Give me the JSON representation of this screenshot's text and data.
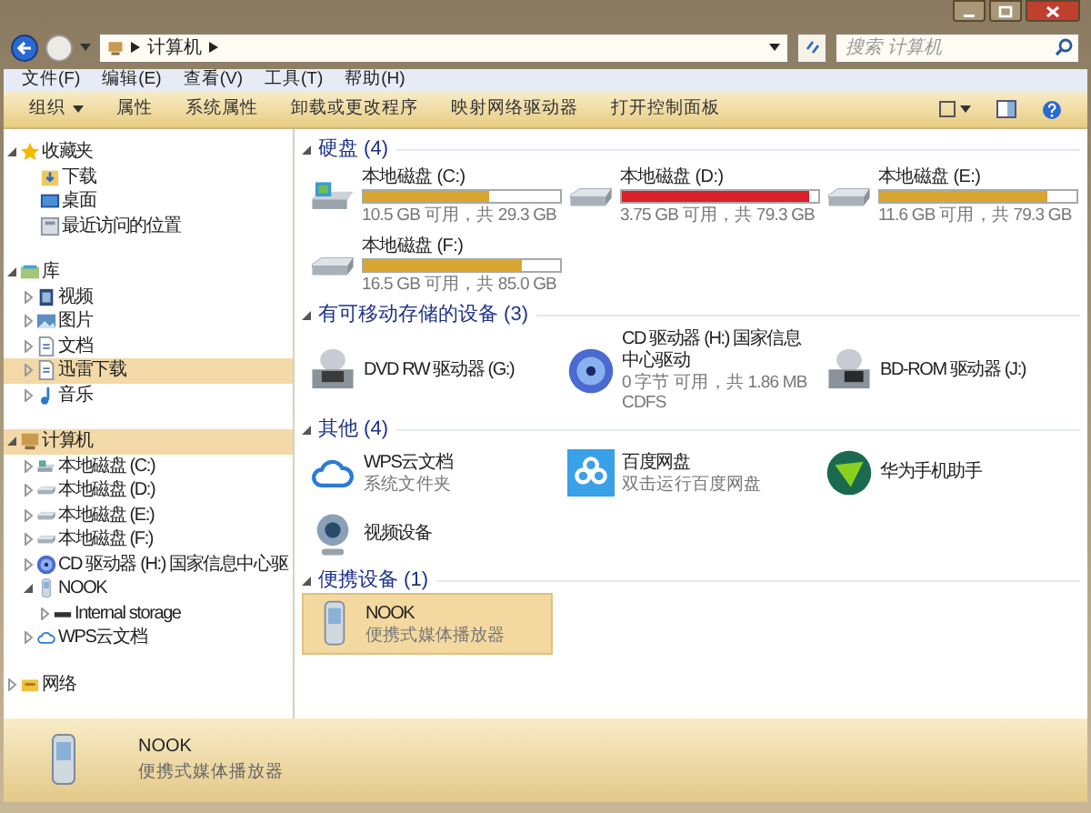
{
  "address_bar": {
    "crumbs": [
      "计算机"
    ],
    "search_placeholder": "搜索 计算机"
  },
  "menu": [
    "文件(F)",
    "编辑(E)",
    "查看(V)",
    "工具(T)",
    "帮助(H)"
  ],
  "toolbar": [
    {
      "label": "组织",
      "kind": "dropdown"
    },
    {
      "label": "属性",
      "kind": "plain"
    },
    {
      "label": "系统属性",
      "kind": "plain"
    },
    {
      "label": "卸载或更改程序",
      "kind": "plain"
    },
    {
      "label": "映射网络驱动器",
      "kind": "plain"
    },
    {
      "label": "打开控制面板",
      "kind": "plain"
    }
  ],
  "sidebar": [
    {
      "label": "收藏夹",
      "kind": "star",
      "expanded": true,
      "selected": false,
      "children": [
        {
          "label": "下载",
          "kind": "download",
          "selected": false
        },
        {
          "label": "桌面",
          "kind": "desktop",
          "selected": false
        },
        {
          "label": "最近访问的位置",
          "kind": "recent",
          "selected": false
        }
      ]
    },
    {
      "label": "库",
      "kind": "library",
      "expanded": true,
      "selected": false,
      "children": [
        {
          "label": "视频",
          "kind": "video",
          "expanded": false,
          "selected": false
        },
        {
          "label": "图片",
          "kind": "picture",
          "expanded": false,
          "selected": false
        },
        {
          "label": "文档",
          "kind": "document",
          "expanded": false,
          "selected": false
        },
        {
          "label": "迅雷下载",
          "kind": "document",
          "expanded": false,
          "selected": true
        },
        {
          "label": "音乐",
          "kind": "music",
          "expanded": false,
          "selected": false
        }
      ]
    },
    {
      "label": "计算机",
      "kind": "computer",
      "expanded": true,
      "selected": true,
      "children": [
        {
          "label": "本地磁盘 (C:)",
          "kind": "system-drive",
          "expanded": false,
          "selected": false
        },
        {
          "label": "本地磁盘 (D:)",
          "kind": "drive",
          "expanded": false,
          "selected": false
        },
        {
          "label": "本地磁盘 (E:)",
          "kind": "drive",
          "expanded": false,
          "selected": false
        },
        {
          "label": "本地磁盘 (F:)",
          "kind": "drive",
          "expanded": false,
          "selected": false
        },
        {
          "label": "CD 驱动器 (H:) 国家信息中心驱",
          "kind": "disc",
          "expanded": false,
          "selected": false
        },
        {
          "label": "NOOK",
          "kind": "device",
          "expanded": true,
          "selected": false,
          "children": [
            {
              "label": "Internal storage",
              "kind": "storage",
              "expanded": false,
              "selected": false
            }
          ]
        },
        {
          "label": "WPS云文档",
          "kind": "cloud",
          "expanded": false,
          "selected": false
        }
      ]
    },
    {
      "label": "网络",
      "kind": "network",
      "expanded": false,
      "selected": false
    }
  ],
  "sections": [
    {
      "title": "硬盘 (4)",
      "items": [
        {
          "kind": "system-drive",
          "name": "本地磁盘 (C:)",
          "level": 0.64,
          "color": "#d8a630",
          "space": "10.5 GB 可用，共 29.3 GB"
        },
        {
          "kind": "drive",
          "name": "本地磁盘 (D:)",
          "level": 0.95,
          "color": "#d8202a",
          "space": "3.75 GB 可用，共 79.3 GB"
        },
        {
          "kind": "drive",
          "name": "本地磁盘 (E:)",
          "level": 0.85,
          "color": "#d8a630",
          "space": "11.6 GB 可用，共 79.3 GB"
        },
        {
          "kind": "drive",
          "name": "本地磁盘 (F:)",
          "level": 0.81,
          "color": "#d8a630",
          "space": "16.5 GB 可用，共 85.0 GB"
        }
      ]
    },
    {
      "title": "有可移动存储的设备 (3)",
      "items": [
        {
          "kind": "dvd",
          "name": "DVD RW 驱动器 (G:)",
          "selected": false
        },
        {
          "kind": "disc",
          "name": "CD 驱动器 (H:) 国家信息中心驱动",
          "lines": [
            "0 字节 可用，共 1.86 MB",
            "CDFS"
          ],
          "selected": false
        },
        {
          "kind": "bd",
          "name": "BD-ROM 驱动器 (J:)",
          "selected": false
        }
      ]
    },
    {
      "title": "其他 (4)",
      "items": [
        {
          "kind": "cloud",
          "name": "WPS云文档",
          "lines": [
            "系统文件夹"
          ],
          "selected": false
        },
        {
          "kind": "baidu",
          "name": "百度网盘",
          "lines": [
            "双击运行百度网盘"
          ],
          "selected": false
        },
        {
          "kind": "huawei",
          "name": "华为手机助手",
          "selected": false
        },
        {
          "kind": "webcam",
          "name": "视频设备",
          "selected": false
        }
      ]
    },
    {
      "title": "便携设备 (1)",
      "items": [
        {
          "kind": "device",
          "name": "NOOK",
          "lines": [
            "便携式媒体播放器"
          ],
          "selected": true
        }
      ]
    }
  ],
  "details": {
    "name": "NOOK",
    "type": "便携式媒体播放器"
  }
}
